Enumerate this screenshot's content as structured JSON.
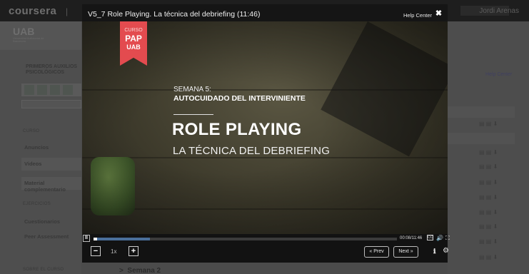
{
  "background": {
    "brand": "coursera",
    "brand_sep": "|",
    "user_name": "Jordi Arenas",
    "logo": "UAB",
    "logo_sub": "Universitat Autònoma de Barcelona",
    "course_title": "PRIMEROS AUXILIOS PSICOLÓGICOS",
    "sections": {
      "curso": "CURSO",
      "ejercicios": "EJERCICIOS",
      "sobre": "SOBRE EL CURSO"
    },
    "items": [
      "Anuncios",
      "Videos",
      "Material complementario",
      "Cuestionarios",
      "Peer Assessment"
    ],
    "help_center": "Help Center",
    "semana2": "Semana 2",
    "row_icons": "▤ ▤ ⬇"
  },
  "modal": {
    "title": "V5_7 Role Playing. La técnica del debriefing (11:46)",
    "help_link": "Help Center",
    "close_icon": "✖"
  },
  "video": {
    "ribbon": {
      "curso": "CURSO",
      "pap": "PAP",
      "uab": "UAB"
    },
    "semana": "SEMANA 5:",
    "autocuidado": "AUTOCUIDADO DEL INTERVINIENTE",
    "role": "ROLE PLAYING",
    "tecnica": "LA TÉCNICA DEL DEBRIEFING"
  },
  "controls": {
    "play_icon": "II",
    "time": "00:08/11:46",
    "progress_fraction": 0.012,
    "buffer_fraction": 0.185,
    "cc_icon": "CC",
    "volume_icon": "🔊",
    "fullscreen_icon": "⛶",
    "minus": "−",
    "plus": "+",
    "speed": "1x",
    "prev": "« Prev",
    "next": "Next »",
    "info_icon": "ℹ",
    "gear_icon": "⚙"
  }
}
